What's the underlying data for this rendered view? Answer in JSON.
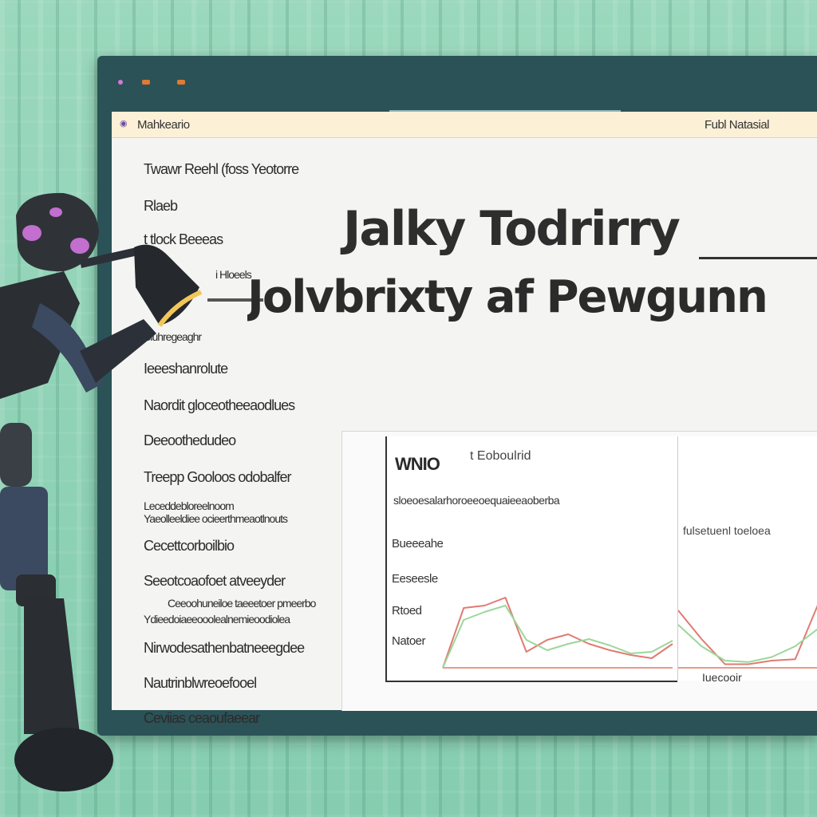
{
  "window": {
    "tab_label": "Mahkeario",
    "tab_icon": "globe-icon",
    "address_right": "Fubl Natasial"
  },
  "sidebar": {
    "items": [
      "Twawr Reehl (foss Yeotorre",
      "Rlaeb",
      "t tlock Beeeas",
      "i Hloeels",
      "Siuhregeaghr",
      "Ieeeshanrolute",
      "Naordit gloceotheeaodlues",
      "Deeoothedudeo",
      "Treepp Gooloos odobalfer",
      "Leceddebloreelnoom",
      "Cecettcorboilbio",
      "Seeotcoaofoet atveeyder",
      "Nirwodesathenbatneeegdee",
      "Nautrinblwreoefooel",
      "Ceviias ceaoufaeear"
    ],
    "sub_items": [
      "Yaeolleeldiee ocieerthmeaotlnouts",
      "Ceeoohuneiloe taeeetoer pmeerbo",
      "Ydieedoiaeeooolealnemieoodiolea"
    ]
  },
  "hero": {
    "line1": "Jalky Todrirry",
    "line2": "Jolvbrixty af Pewgunn"
  },
  "chart_panel": {
    "title": "WNIO",
    "subtitle": "t Eoboulrid",
    "caption": "sloeoesalarhoroeeoequaieeaoberba",
    "y_labels": [
      "Bueeeahe",
      "Eeseesle",
      "Rtoed",
      "Natoer"
    ],
    "side_label": "fulsetuenl toeloea",
    "side_x_label": "Iuecooir"
  },
  "chart_data": {
    "type": "line",
    "series": [
      {
        "values": [
          0,
          0.75,
          0.78,
          0.88,
          0.2,
          0.35,
          0.42,
          0.3,
          0.22,
          0.16,
          0.12,
          0.3
        ]
      },
      {
        "values": [
          0,
          0.6,
          0.7,
          0.78,
          0.35,
          0.22,
          0.3,
          0.36,
          0.28,
          0.18,
          0.2,
          0.34
        ]
      }
    ],
    "series_colors": [
      "#e07b72",
      "#9bd79a"
    ],
    "ylim": [
      0,
      1
    ]
  },
  "side_chart_data": {
    "series": [
      {
        "values": [
          0.8,
          0.4,
          0.05,
          0.05,
          0.1,
          0.12,
          0.9
        ]
      },
      {
        "values": [
          0.6,
          0.3,
          0.1,
          0.08,
          0.15,
          0.3,
          0.55
        ]
      }
    ],
    "series_colors": [
      "#e07b72",
      "#9bd79a"
    ]
  }
}
